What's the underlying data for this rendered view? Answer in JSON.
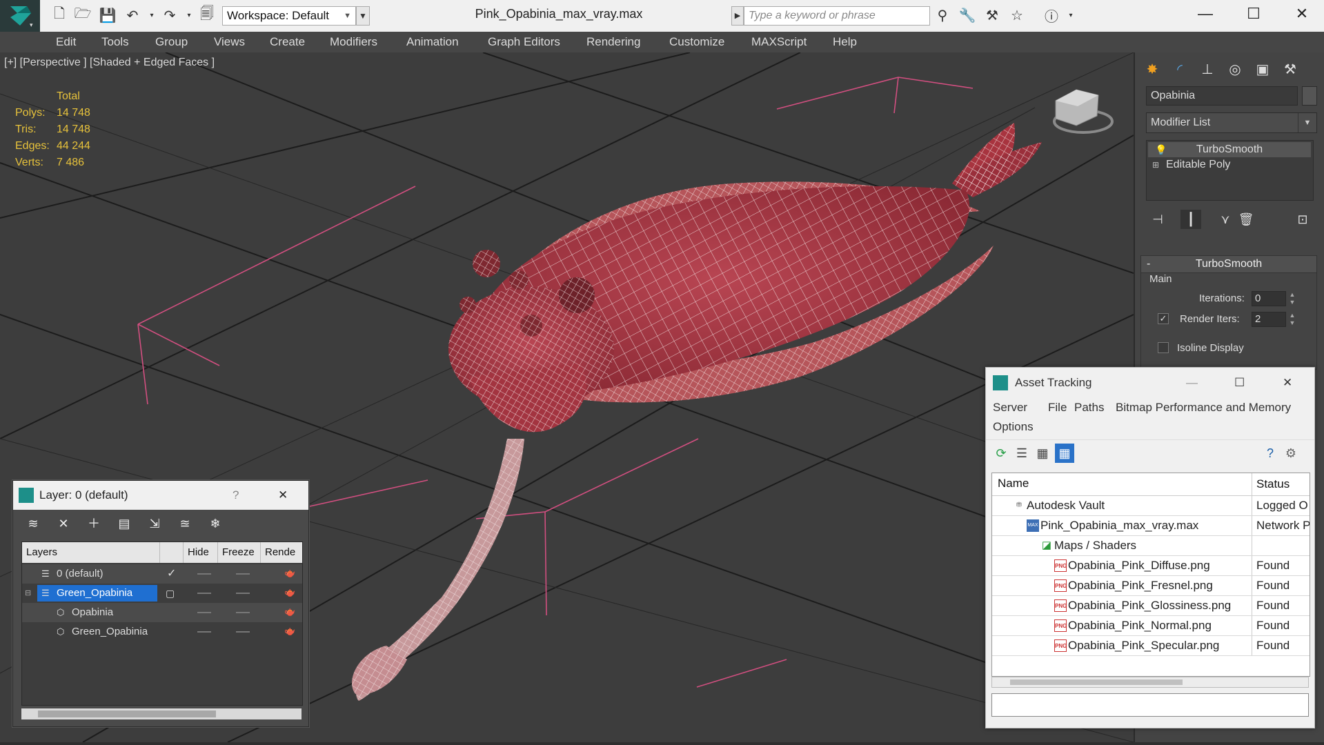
{
  "window": {
    "title": "Pink_Opabinia_max_vray.max",
    "minimize": "—",
    "maximize": "☐",
    "close": "✕"
  },
  "toolbar": {
    "workspace_label": "Workspace: Default",
    "search_placeholder": "Type a keyword or phrase"
  },
  "menu": [
    "Edit",
    "Tools",
    "Group",
    "Views",
    "Create",
    "Modifiers",
    "Animation",
    "Graph Editors",
    "Rendering",
    "Customize",
    "MAXScript",
    "Help"
  ],
  "viewport": {
    "label": "[+] [Perspective ] [Shaded + Edged Faces ]",
    "stats": {
      "header": "Total",
      "rows": [
        {
          "k": "Polys:",
          "v": "14 748"
        },
        {
          "k": "Tris:",
          "v": "14 748"
        },
        {
          "k": "Edges:",
          "v": "44 244"
        },
        {
          "k": "Verts:",
          "v": "7 486"
        }
      ]
    }
  },
  "command_panel": {
    "object_name": "Opabinia",
    "modifier_list": "Modifier List",
    "stack": [
      "TurboSmooth",
      "Editable Poly"
    ],
    "rollout": {
      "collapse": "-",
      "title": "TurboSmooth",
      "group": "Main",
      "iterations_label": "Iterations:",
      "iterations_value": "0",
      "render_iters_label": "Render Iters:",
      "render_iters_value": "2",
      "isoline_label": "Isoline Display"
    }
  },
  "layer_dialog": {
    "title": "Layer: 0 (default)",
    "help": "?",
    "close": "✕",
    "columns": [
      "Layers",
      "Hide",
      "Freeze",
      "Rende"
    ],
    "rows": [
      {
        "name": "0 (default)"
      },
      {
        "name": "Green_Opabinia"
      },
      {
        "name": "Opabinia"
      },
      {
        "name": "Green_Opabinia"
      }
    ]
  },
  "asset_tracking": {
    "title": "Asset Tracking",
    "menu": [
      "Server",
      "File",
      "Paths",
      "Bitmap Performance and Memory",
      "Options"
    ],
    "columns": [
      "Name",
      "Status"
    ],
    "rows": [
      {
        "name": "Autodesk Vault",
        "status": "Logged O"
      },
      {
        "name": "Pink_Opabinia_max_vray.max",
        "status": "Network P"
      },
      {
        "name": "Maps / Shaders",
        "status": ""
      },
      {
        "name": "Opabinia_Pink_Diffuse.png",
        "status": "Found"
      },
      {
        "name": "Opabinia_Pink_Fresnel.png",
        "status": "Found"
      },
      {
        "name": "Opabinia_Pink_Glossiness.png",
        "status": "Found"
      },
      {
        "name": "Opabinia_Pink_Normal.png",
        "status": "Found"
      },
      {
        "name": "Opabinia_Pink_Specular.png",
        "status": "Found"
      }
    ]
  },
  "colors": {
    "stats_text": "#e7c23b",
    "grid_line": "#111111",
    "helper_pink": "#d24f80",
    "model_fill": "#a8343f",
    "wire": "#f2e6e6",
    "selection": "#1f6fd1"
  }
}
